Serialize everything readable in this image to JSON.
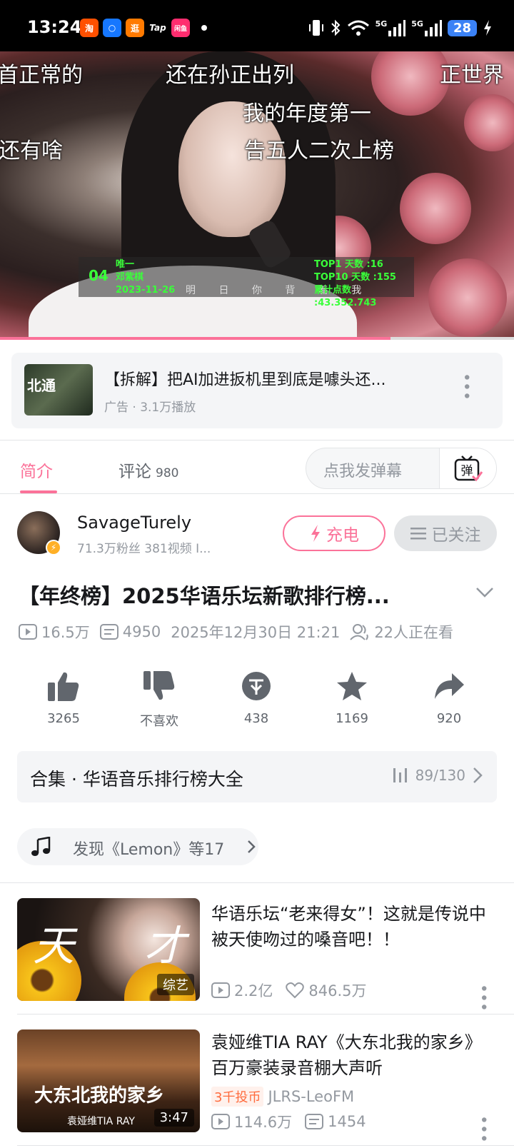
{
  "status_bar": {
    "time": "13:24",
    "app_icons": [
      "淘",
      "○",
      "逛",
      "Tap",
      "闲鱼"
    ],
    "network": "5G",
    "battery": "28"
  },
  "player": {
    "danmaku": [
      "首正常的",
      "还在孙正出列",
      "正世界",
      "我的年度第一",
      "还有啥",
      "告五人二次上榜"
    ],
    "rank_number": "04",
    "rank_song": "唯一",
    "rank_artist": "邓紫棋",
    "rank_date": "2023-11-26",
    "rank_top1": "TOP1 天数 :16",
    "rank_top10": "TOP10 天数 :155",
    "rank_total": "累计点数 :43.352.743",
    "lyric": "明 日 你 背 着 我",
    "progress": 0.76
  },
  "ad": {
    "thumb_text": "北通",
    "title": "【拆解】把AI加进扳机里到底是噱头还...",
    "meta": "广告 · 3.1万播放"
  },
  "tabs": {
    "intro": "简介",
    "comments": "评论",
    "comments_count": "980",
    "danmaku_placeholder": "点我发弹幕",
    "danmaku_button": "弹"
  },
  "uploader": {
    "name": "SavageTurely",
    "stats": "71.3万粉丝   381视频   I...",
    "charge_label": "充电",
    "follow_label": "已关注"
  },
  "video": {
    "title": "【年终榜】2025华语乐坛新歌排行榜...",
    "views": "16.5万",
    "danmaku_count": "4950",
    "date": "2025年12月30日 21:21",
    "watching": "22人正在看"
  },
  "actions": {
    "like": "3265",
    "dislike": "不喜欢",
    "coin": "438",
    "favorite": "1169",
    "share": "920"
  },
  "collection": {
    "title": "合集 · 华语音乐排行榜大全",
    "progress": "89/130"
  },
  "music": {
    "text": "发现《Lemon》等17"
  },
  "recommendations": [
    {
      "thumb_text_1": "天",
      "thumb_text_2": "才",
      "corner": "综艺",
      "title": "华语乐坛“老来得女”！这就是传说中被天使吻过的嗓音吧！！",
      "views": "2.2亿",
      "likes": "846.5万"
    },
    {
      "thumb_text": "大东北我的家乡",
      "thumb_sub": "袁娅维TIA RAY",
      "corner": "3:47",
      "title": "袁娅维TIA RAY《大东北我的家乡》百万豪装录音棚大声听",
      "coin_badge": "3千投币",
      "author": "JLRS-LeoFM",
      "views": "114.6万",
      "danmaku": "1454"
    }
  ],
  "colors": {
    "accent": "#fb7299",
    "text_secondary": "#9499a0",
    "status_bar": "#000000"
  }
}
